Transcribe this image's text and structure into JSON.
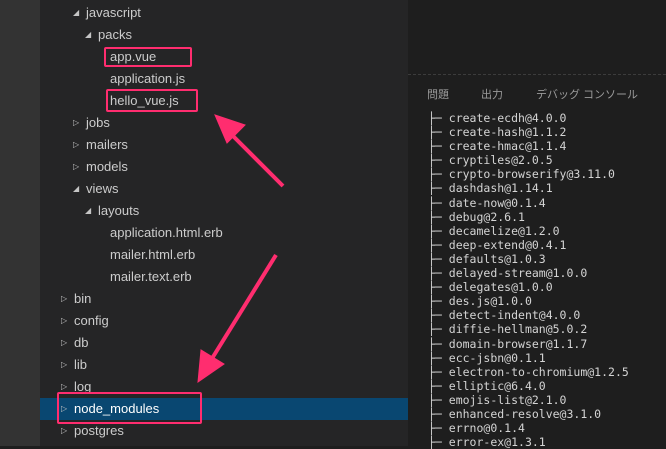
{
  "explorer": {
    "items": [
      {
        "label": "javascript",
        "level": 2,
        "type": "folder",
        "expanded": true
      },
      {
        "label": "packs",
        "level": 3,
        "type": "folder",
        "expanded": true
      },
      {
        "label": "app.vue",
        "level": 4,
        "type": "file",
        "highlighted": true
      },
      {
        "label": "application.js",
        "level": 4,
        "type": "file"
      },
      {
        "label": "hello_vue.js",
        "level": 4,
        "type": "file",
        "highlighted": true
      },
      {
        "label": "jobs",
        "level": 2,
        "type": "folder",
        "expanded": false
      },
      {
        "label": "mailers",
        "level": 2,
        "type": "folder",
        "expanded": false
      },
      {
        "label": "models",
        "level": 2,
        "type": "folder",
        "expanded": false
      },
      {
        "label": "views",
        "level": 2,
        "type": "folder",
        "expanded": true
      },
      {
        "label": "layouts",
        "level": 3,
        "type": "folder",
        "expanded": true
      },
      {
        "label": "application.html.erb",
        "level": 4,
        "type": "file"
      },
      {
        "label": "mailer.html.erb",
        "level": 4,
        "type": "file"
      },
      {
        "label": "mailer.text.erb",
        "level": 4,
        "type": "file"
      },
      {
        "label": "bin",
        "level": 1,
        "type": "folder",
        "expanded": false
      },
      {
        "label": "config",
        "level": 1,
        "type": "folder",
        "expanded": false
      },
      {
        "label": "db",
        "level": 1,
        "type": "folder",
        "expanded": false
      },
      {
        "label": "lib",
        "level": 1,
        "type": "folder",
        "expanded": false
      },
      {
        "label": "log",
        "level": 1,
        "type": "folder",
        "expanded": false
      },
      {
        "label": "node_modules",
        "level": 1,
        "type": "folder",
        "expanded": false,
        "selected": true,
        "highlighted": true
      },
      {
        "label": "postgres",
        "level": 1,
        "type": "folder",
        "expanded": false
      }
    ]
  },
  "panel": {
    "tabs": [
      "問題",
      "出力",
      "デバッグ コンソール"
    ],
    "output": [
      "create-ecdh@4.0.0",
      "create-hash@1.1.2",
      "create-hmac@1.1.4",
      "cryptiles@2.0.5",
      "crypto-browserify@3.11.0",
      "dashdash@1.14.1",
      "date-now@0.1.4",
      "debug@2.6.1",
      "decamelize@1.2.0",
      "deep-extend@0.4.1",
      "defaults@1.0.3",
      "delayed-stream@1.0.0",
      "delegates@1.0.0",
      "des.js@1.0.0",
      "detect-indent@4.0.0",
      "diffie-hellman@5.0.2",
      "domain-browser@1.1.7",
      "ecc-jsbn@0.1.1",
      "electron-to-chromium@1.2.5",
      "elliptic@6.4.0",
      "emojis-list@2.1.0",
      "enhanced-resolve@3.1.0",
      "errno@0.1.4",
      "error-ex@1.3.1"
    ]
  },
  "colors": {
    "annotation": "#ff2d6f",
    "selection": "#094771",
    "sidebar": "#252526"
  }
}
